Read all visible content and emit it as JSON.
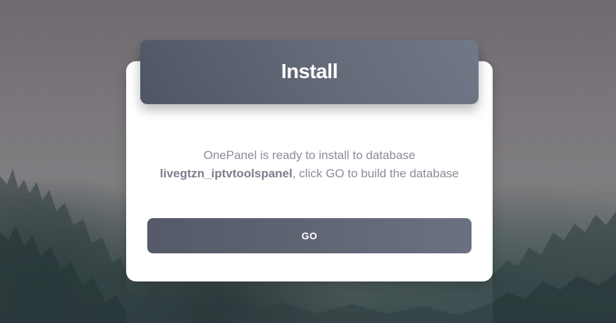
{
  "install": {
    "title": "Install",
    "message_prefix": "OnePanel is ready to install to database",
    "database_name": "livegtzn_iptvtoolspanel",
    "message_suffix": ", click GO to build the database",
    "go_label": "GO"
  },
  "colors": {
    "header_gradient_start": "#4e5563",
    "header_gradient_end": "#717887",
    "message_text": "#8d8a99",
    "button_bg": "#5f6573",
    "card_bg": "#ffffff"
  }
}
